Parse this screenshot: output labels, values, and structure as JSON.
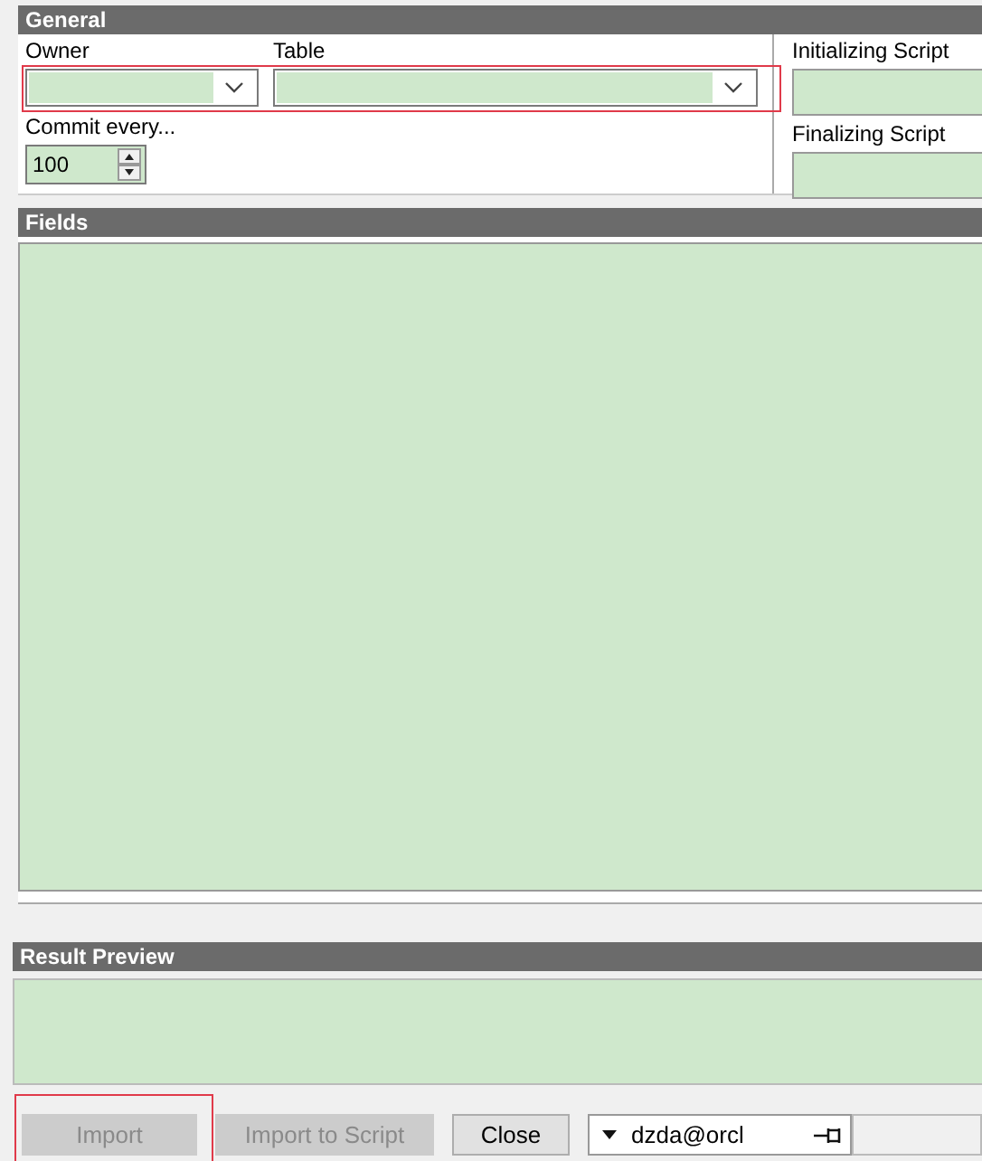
{
  "general": {
    "title": "General",
    "owner": {
      "label": "Owner"
    },
    "table": {
      "label": "Table"
    },
    "commit": {
      "label": "Commit every...",
      "value": "100"
    },
    "initializing_script": {
      "label": "Initializing Script"
    },
    "finalizing_script": {
      "label": "Finalizing Script"
    },
    "highlighted": true
  },
  "fields": {
    "title": "Fields"
  },
  "result_preview": {
    "title": "Result Preview"
  },
  "buttons": [
    {
      "label": "Import",
      "disabled": true,
      "highlighted": true
    },
    {
      "label": "Import to Script",
      "disabled": true,
      "highlighted": false
    },
    {
      "label": "Close",
      "disabled": false,
      "highlighted": false
    }
  ],
  "connection": {
    "value": "dzda@orcl"
  }
}
